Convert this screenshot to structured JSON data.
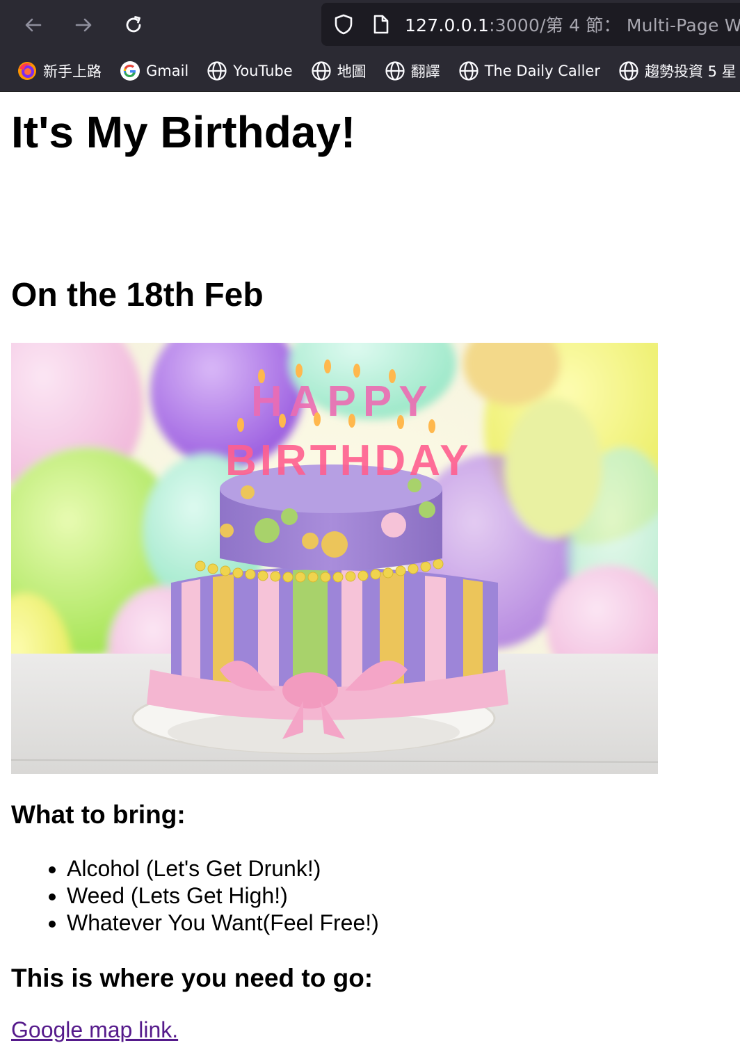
{
  "browser": {
    "url_host": "127.0.0.1",
    "url_rest": ":3000/第 4 節： Multi-Page W",
    "bookmarks": [
      {
        "icon": "firefox-icon",
        "label": "新手上路"
      },
      {
        "icon": "google-icon",
        "label": "Gmail"
      },
      {
        "icon": "globe-icon",
        "label": "YouTube"
      },
      {
        "icon": "globe-icon",
        "label": "地圖"
      },
      {
        "icon": "globe-icon",
        "label": "翻譯"
      },
      {
        "icon": "globe-icon",
        "label": "The Daily Caller"
      },
      {
        "icon": "globe-icon",
        "label": "趨勢投資 5 星"
      }
    ]
  },
  "page": {
    "title": "It's My Birthday!",
    "date_heading": "On the 18th Feb",
    "bring_heading": "What to bring:",
    "bring_items": [
      "Alcohol (Let's Get Drunk!)",
      "Weed (Lets Get High!)",
      "Whatever You Want(Feel Free!)"
    ],
    "where_heading": "This is where you need to go:",
    "map_link": "Google map link."
  },
  "image": {
    "candle_text_top": "HAPPY",
    "candle_text_bottom": "BIRTHDAY"
  },
  "colors": {
    "chrome_bg": "#2b2a33",
    "urlbar_bg": "#1c1b22",
    "link_visited": "#551a8b"
  }
}
